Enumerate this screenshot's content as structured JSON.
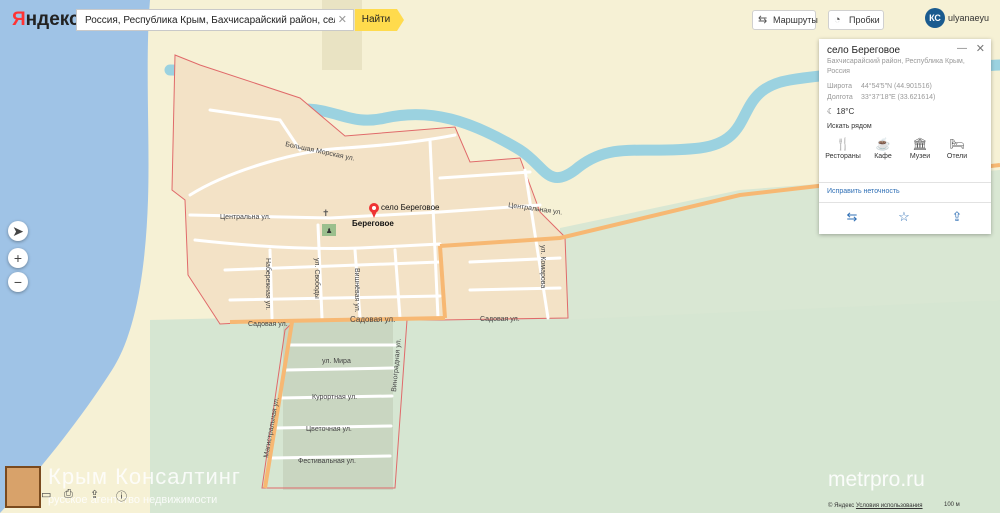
{
  "header": {
    "logo_first": "Я",
    "logo_rest": "ндекс",
    "search_value": "Россия, Республика Крым, Бахчисарайский район, село Береговое",
    "find_label": "Найти",
    "routes_label": "Маршруты",
    "traffic_label": "Пробки",
    "user_initials": "КС",
    "user_name": "ulyanaeyu"
  },
  "map": {
    "village_name": "Береговое",
    "marker_label": "село Береговое",
    "streets": {
      "bolshaya_morskaya": "Большая Морская ул.",
      "centralnaya_w": "Центральна ул.",
      "centralnaya_e": "Центральная ул.",
      "naberezhnaya": "Набережная ул.",
      "sadovaya_main": "Садовая ул.",
      "sadovaya_e": "Садовая ул.",
      "sadovaya_w": "Садовая ул.",
      "svobody": "ул. Свободы",
      "vishnyovaya": "Вишнёвая ул.",
      "komarova": "ул. Комарова",
      "mira": "ул. Мира",
      "kurortnaya": "Курортная ул.",
      "tsvetochnaya": "Цветочная ул.",
      "festivalnaya": "Фестивальная ул.",
      "magistralnaya": "Магистральная ул.",
      "vinogradnaya": "Виноградная ул."
    }
  },
  "place_card": {
    "title": "село Береговое",
    "address": "Бахчисарайский район, Республика Крым, Россия",
    "lat_label": "Широта",
    "lat_value": "44°54′5″N (44.901516)",
    "lon_label": "Долгота",
    "lon_value": "33°37′18″E (33.621614)",
    "weather": "18°C",
    "nearby_label": "Искать рядом",
    "categories": [
      "Рестораны",
      "Кафе",
      "Музеи",
      "Отели"
    ],
    "fix_link": "Исправить неточность"
  },
  "footer": {
    "watermark": "metrpro.ru",
    "brand_name": "Крым Консалтинг",
    "brand_sub": "русское агентство недвижимости",
    "copyright_prefix": "© Яндекс",
    "terms_link": "Условия использования",
    "scale": "100 м"
  },
  "colors": {
    "sea": "#9fc3e6",
    "land": "#f6f1d5",
    "village": "#f3e2c6",
    "river": "#9bd2e0",
    "main_road": "#f7b873",
    "fields": "#d6e6d2",
    "boundary": "#e06a6a",
    "accent": "#ffdb4d"
  }
}
